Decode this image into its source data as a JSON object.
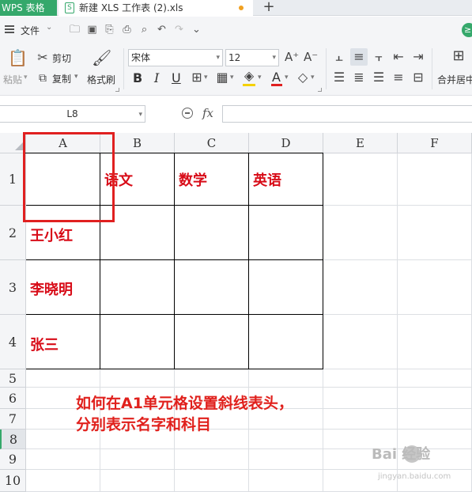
{
  "tabs": {
    "app": "WPS 表格",
    "doc": "新建 XLS 工作表 (2).xls",
    "add": "+"
  },
  "menu": {
    "file": "文件",
    "badge": "≥"
  },
  "ribbon": {
    "paste": "粘贴",
    "cut": "剪切",
    "copy": "复制",
    "format_painter": "格式刷",
    "font_name": "宋体",
    "font_size": "12",
    "bold": "B",
    "italic": "I",
    "underline": "U",
    "merge_center": "合并居中"
  },
  "formula_bar": {
    "cell_ref": "L8",
    "fx": "fx"
  },
  "grid": {
    "columns": [
      "A",
      "B",
      "C",
      "D",
      "E",
      "F"
    ],
    "rows": [
      "1",
      "2",
      "3",
      "4",
      "5",
      "6",
      "7",
      "8",
      "9",
      "10"
    ],
    "header_subjects": [
      "语文",
      "数学",
      "英语"
    ],
    "names": [
      "王小红",
      "李晓明",
      "张三"
    ]
  },
  "annotation": {
    "line1": "如何在A1单元格设置斜线表头，",
    "line2": "分别表示名字和科目"
  },
  "watermark": {
    "main": "Bai  经验",
    "sub": "jingyan.baidu.com"
  },
  "colors": {
    "wps_green": "#35a86b",
    "cell_text_red": "#d80c18",
    "highlight_box": "#e02020"
  }
}
